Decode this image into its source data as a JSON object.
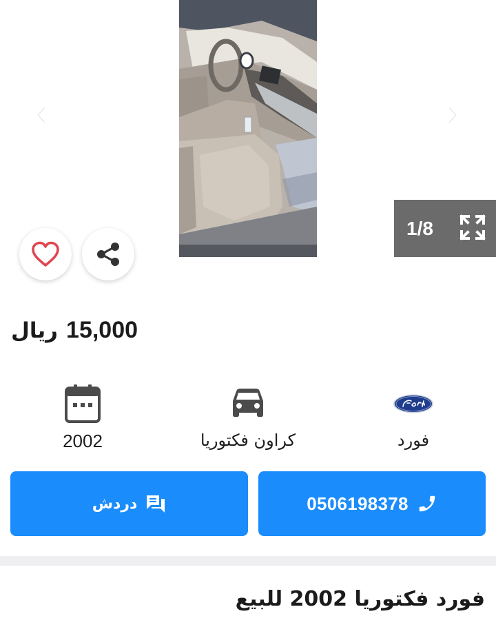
{
  "gallery": {
    "counter": "1/8",
    "icons": {
      "prev": "chevron-left-icon",
      "next": "chevron-right-icon",
      "expand": "fullscreen-icon",
      "favorite": "heart-icon",
      "share": "share-icon"
    }
  },
  "price": {
    "value": "15,000",
    "currency": "ريال"
  },
  "specs": [
    {
      "key": "year",
      "icon": "calendar-icon",
      "label": "2002"
    },
    {
      "key": "model",
      "icon": "car-icon",
      "label": "كراون فكتوريا"
    },
    {
      "key": "make",
      "icon": "ford-logo-icon",
      "label": "فورد"
    }
  ],
  "actions": {
    "chat": {
      "label": "دردش",
      "icon": "chat-icon"
    },
    "call": {
      "label": "0506198378",
      "icon": "phone-icon"
    }
  },
  "listing": {
    "title": "فورد فكتوريا 2002 للبيع"
  },
  "colors": {
    "accent": "#1a8cfb",
    "heart": "#e0454f",
    "counter_bg": "#6b6b6b",
    "separator": "#efeff2"
  }
}
